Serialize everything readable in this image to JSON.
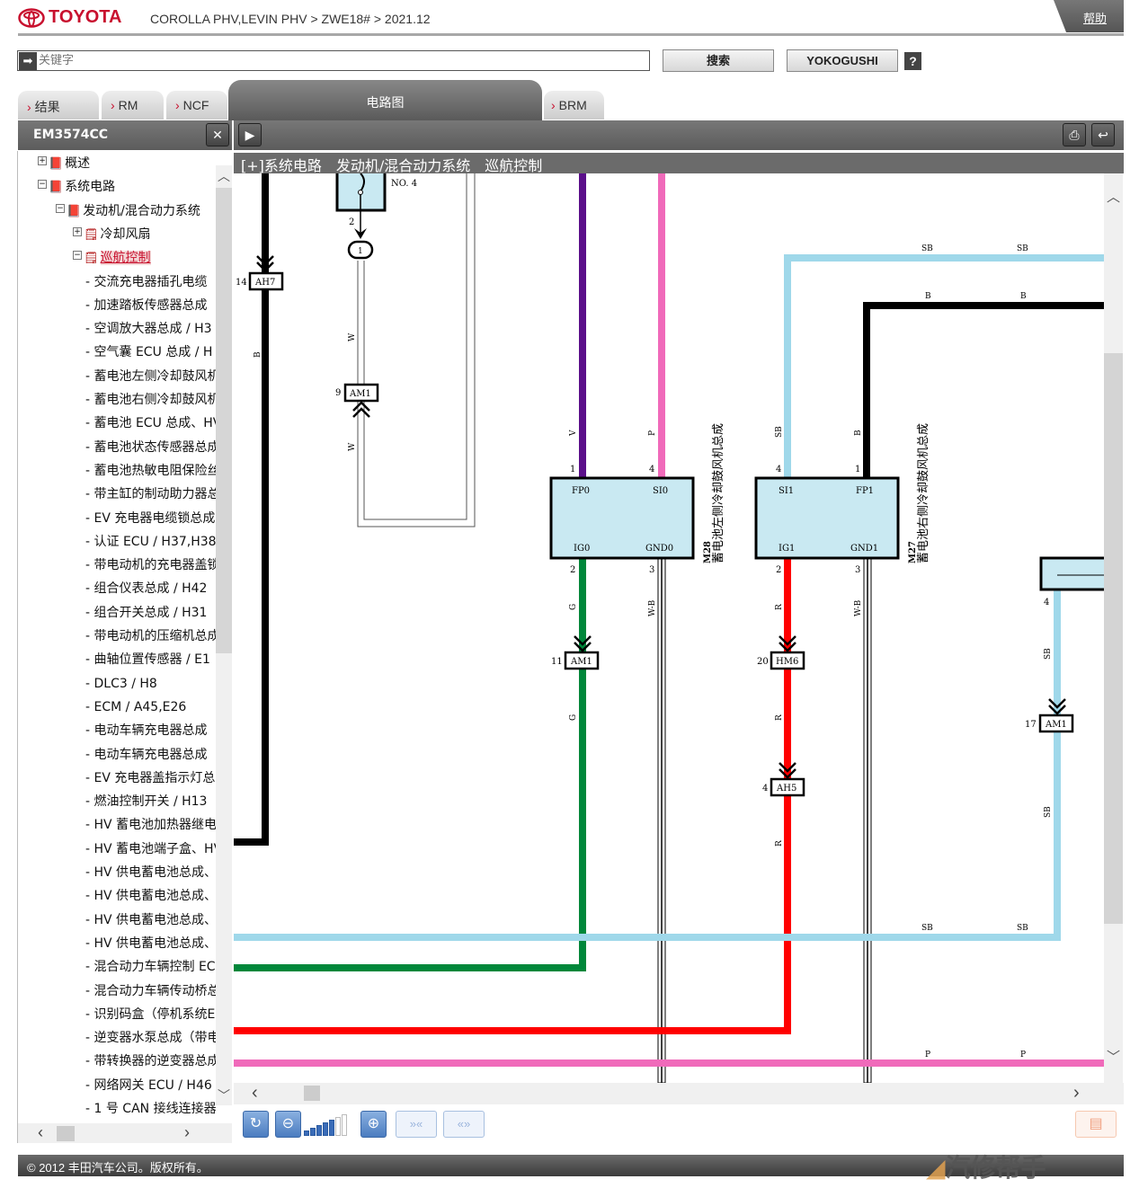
{
  "header": {
    "brand": "TOYOTA",
    "breadcrumb": "COROLLA PHV,LEVIN PHV > ZWE18# > 2021.12",
    "help": "帮助"
  },
  "search": {
    "placeholder": "关键字",
    "search_button": "搜索",
    "yokogushi_button": "YOKOGUSHI",
    "help_icon": "?"
  },
  "tabs": [
    {
      "label": "结果"
    },
    {
      "label": "RM"
    },
    {
      "label": "NCF"
    },
    {
      "label": "电路图",
      "active": true
    },
    {
      "label": "BRM"
    }
  ],
  "left_panel": {
    "title": "EM3574CC",
    "close": "✕"
  },
  "tree": [
    {
      "level": 0,
      "toggle": "+",
      "icon": "book",
      "label": "概述"
    },
    {
      "level": 0,
      "toggle": "−",
      "icon": "book",
      "label": "系统电路"
    },
    {
      "level": 1,
      "toggle": "−",
      "icon": "book",
      "label": "发动机/混合动力系统"
    },
    {
      "level": 2,
      "toggle": "+",
      "icon": "doc",
      "label": "冷却风扇"
    },
    {
      "level": 2,
      "toggle": "−",
      "icon": "doc",
      "label": "巡航控制",
      "selected": true
    },
    {
      "level": 3,
      "label": "交流充电器插孔电缆"
    },
    {
      "level": 3,
      "label": "加速踏板传感器总成"
    },
    {
      "level": 3,
      "label": "空调放大器总成 / H3"
    },
    {
      "level": 3,
      "label": "空气囊 ECU 总成 / H"
    },
    {
      "level": 3,
      "label": "蓄电池左侧冷却鼓风机"
    },
    {
      "level": 3,
      "label": "蓄电池右侧冷却鼓风机"
    },
    {
      "level": 3,
      "label": "蓄电池 ECU 总成、HV"
    },
    {
      "level": 3,
      "label": "蓄电池状态传感器总成"
    },
    {
      "level": 3,
      "label": "蓄电池热敏电阻保险丝"
    },
    {
      "level": 3,
      "label": "带主缸的制动助力器总"
    },
    {
      "level": 3,
      "label": "EV 充电器电缆锁总成"
    },
    {
      "level": 3,
      "label": "认证 ECU / H37,H38,"
    },
    {
      "level": 3,
      "label": "带电动机的充电器盖锁"
    },
    {
      "level": 3,
      "label": "组合仪表总成 / H42"
    },
    {
      "level": 3,
      "label": "组合开关总成 / H31"
    },
    {
      "level": 3,
      "label": "带电动机的压缩机总成"
    },
    {
      "level": 3,
      "label": "曲轴位置传感器 / E1"
    },
    {
      "level": 3,
      "label": "DLC3 / H8"
    },
    {
      "level": 3,
      "label": "ECM / A45,E26"
    },
    {
      "level": 3,
      "label": "电动车辆充电器总成"
    },
    {
      "level": 3,
      "label": "电动车辆充电器总成"
    },
    {
      "level": 3,
      "label": "EV 充电器盖指示灯总"
    },
    {
      "level": 3,
      "label": "燃油控制开关 / H13"
    },
    {
      "level": 3,
      "label": "HV 蓄电池加热器继电"
    },
    {
      "level": 3,
      "label": "HV 蓄电池端子盒、HV"
    },
    {
      "level": 3,
      "label": "HV 供电蓄电池总成、"
    },
    {
      "level": 3,
      "label": "HV 供电蓄电池总成、"
    },
    {
      "level": 3,
      "label": "HV 供电蓄电池总成、"
    },
    {
      "level": 3,
      "label": "HV 供电蓄电池总成、"
    },
    {
      "level": 3,
      "label": "混合动力车辆控制 EC"
    },
    {
      "level": 3,
      "label": "混合动力车辆传动桥总"
    },
    {
      "level": 3,
      "label": "识别码盒（停机系统ECU"
    },
    {
      "level": 3,
      "label": "逆变器水泵总成（带电"
    },
    {
      "level": 3,
      "label": "带转换器的逆变器总成"
    },
    {
      "level": 3,
      "label": "网络网关 ECU / H46"
    },
    {
      "level": 3,
      "label": "1 号 CAN 接线连接器"
    }
  ],
  "diagram": {
    "title_icon": "[+]",
    "title": "系统电路　发动机/混合动力系统　巡航控制",
    "fuse": {
      "label": "NO. 4",
      "pin": "2",
      "junction": "1"
    },
    "connectors": {
      "ah7": {
        "code": "AH7",
        "pin": "14"
      },
      "am1_w": {
        "code": "AM1",
        "pin": "9"
      },
      "am1_g": {
        "code": "AM1",
        "pin": "11"
      },
      "hm6": {
        "code": "HM6",
        "pin": "20"
      },
      "ah5": {
        "code": "AH5",
        "pin": "4"
      },
      "am1_sb": {
        "code": "AM1",
        "pin": "17"
      }
    },
    "components": {
      "m28": {
        "code": "M28",
        "name": "蓄电池左侧冷却鼓风机总成",
        "pins": {
          "fp0": "FP0",
          "si0": "SI0",
          "ig0": "IG0",
          "gnd0": "GND0"
        },
        "pin_nums": {
          "fp0": "1",
          "si0": "4",
          "ig0": "2",
          "gnd0": "3"
        }
      },
      "m27": {
        "code": "M27",
        "name": "蓄电池右侧冷却鼓风机总成",
        "pins": {
          "si1": "SI1",
          "fp1": "FP1",
          "ig1": "IG1",
          "gnd1": "GND1"
        },
        "pin_nums": {
          "si1": "4",
          "fp1": "1",
          "ig1": "2",
          "gnd1": "3"
        }
      },
      "right_pin": "4"
    },
    "wire_colors": {
      "B": "#000000",
      "W": "#ffffff",
      "V": "#5b0f8a",
      "P": "#f06aba",
      "G": "#00873a",
      "W-B": "#ffffff",
      "SB": "#9fd8ea",
      "R": "#ff0000"
    },
    "wire_labels": {
      "B": "B",
      "W": "W",
      "V": "V",
      "P": "P",
      "G": "G",
      "WB": "W-B",
      "SB": "SB",
      "R": "R"
    }
  },
  "toolbar": {
    "zoom_level": 5,
    "zoom_steps": 7
  },
  "footer": {
    "copyright": "© 2012 丰田汽车公司。版权所有。",
    "watermark": "汽修帮手"
  }
}
